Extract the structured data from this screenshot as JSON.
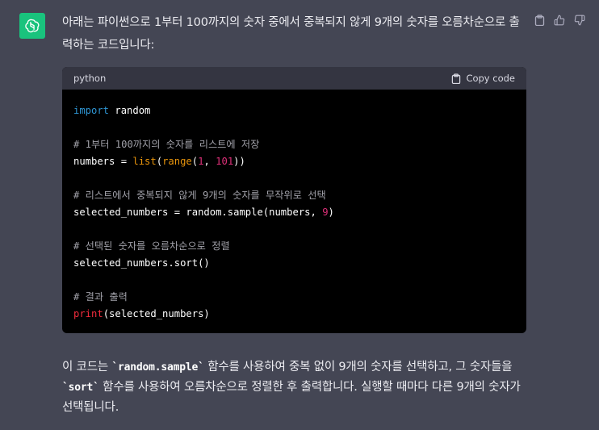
{
  "message": {
    "intro": "아래는 파이썬으로 1부터 100까지의 숫자 중에서 중복되지 않게 9개의 숫자를 오름차순으로 출력하는 코드입니다:",
    "outro_part1": " 이 코드는 ",
    "outro_code1": "`random.sample`",
    "outro_part2": " 함수를 사용하여 중복 없이 9개의 숫자를 선택하고, 그 숫자들을 ",
    "outro_code2": "`sort`",
    "outro_part3": " 함수를 사용하여 오름차순으로 정렬한 후 출력합니다. 실행할 때마다 다른 9개의 숫자가 선택됩니다."
  },
  "code_block": {
    "language": "python",
    "copy_label": "Copy code",
    "lines": {
      "l1_kw": "import",
      "l1_rest": " random",
      "l3_comment": "# 1부터 100까지의 숫자를 리스트에 저장",
      "l4_a": "numbers = ",
      "l4_list": "list",
      "l4_b": "(",
      "l4_range": "range",
      "l4_c": "(",
      "l4_n1": "1",
      "l4_d": ", ",
      "l4_n2": "101",
      "l4_e": "))",
      "l6_comment": "# 리스트에서 중복되지 않게 9개의 숫자를 무작위로 선택",
      "l7_a": "selected_numbers = random.sample(numbers, ",
      "l7_n": "9",
      "l7_b": ")",
      "l9_comment": "# 선택된 숫자를 오름차순으로 정렬",
      "l10": "selected_numbers.sort()",
      "l12_comment": "# 결과 출력",
      "l13_print": "print",
      "l13_rest": "(selected_numbers)"
    }
  },
  "icons": {
    "avatar": "openai-logo-icon",
    "copy": "clipboard-icon",
    "thumbs_up": "thumbs-up-icon",
    "thumbs_down": "thumbs-down-icon"
  },
  "colors": {
    "background": "#444654",
    "avatar_bg": "#19c37d",
    "code_bg": "#000000",
    "code_header_bg": "#343541",
    "keyword": "#2e95d3",
    "function": "#f22c3d",
    "builtin": "#e9950c",
    "number": "#df3079"
  }
}
